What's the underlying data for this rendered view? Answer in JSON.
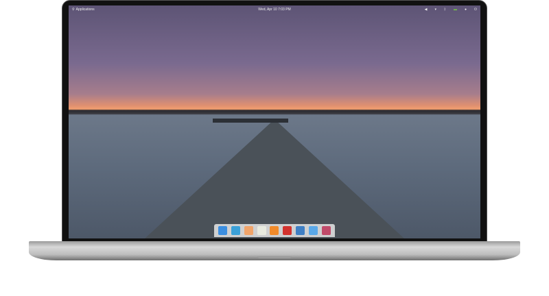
{
  "panel": {
    "applications_label": "Applications",
    "clock": "Wed, Apr 10  7:03 PM",
    "indicators": [
      "volume-icon",
      "network-icon",
      "bluetooth-icon",
      "battery-icon",
      "notifications-icon",
      "power-icon"
    ]
  },
  "dock": {
    "apps": [
      {
        "name": "multitasking-view",
        "color": "#3b8ee0"
      },
      {
        "name": "web-browser",
        "color": "#3aa0d8"
      },
      {
        "name": "mail",
        "color": "#f0a46a"
      },
      {
        "name": "calendar",
        "color": "#e8eadf"
      },
      {
        "name": "music",
        "color": "#f08a2a"
      },
      {
        "name": "videos",
        "color": "#d2322e"
      },
      {
        "name": "photos",
        "color": "#3f7fc4"
      },
      {
        "name": "system-settings",
        "color": "#5aa8e8"
      },
      {
        "name": "appcenter",
        "color": "#c04a6a"
      }
    ]
  }
}
